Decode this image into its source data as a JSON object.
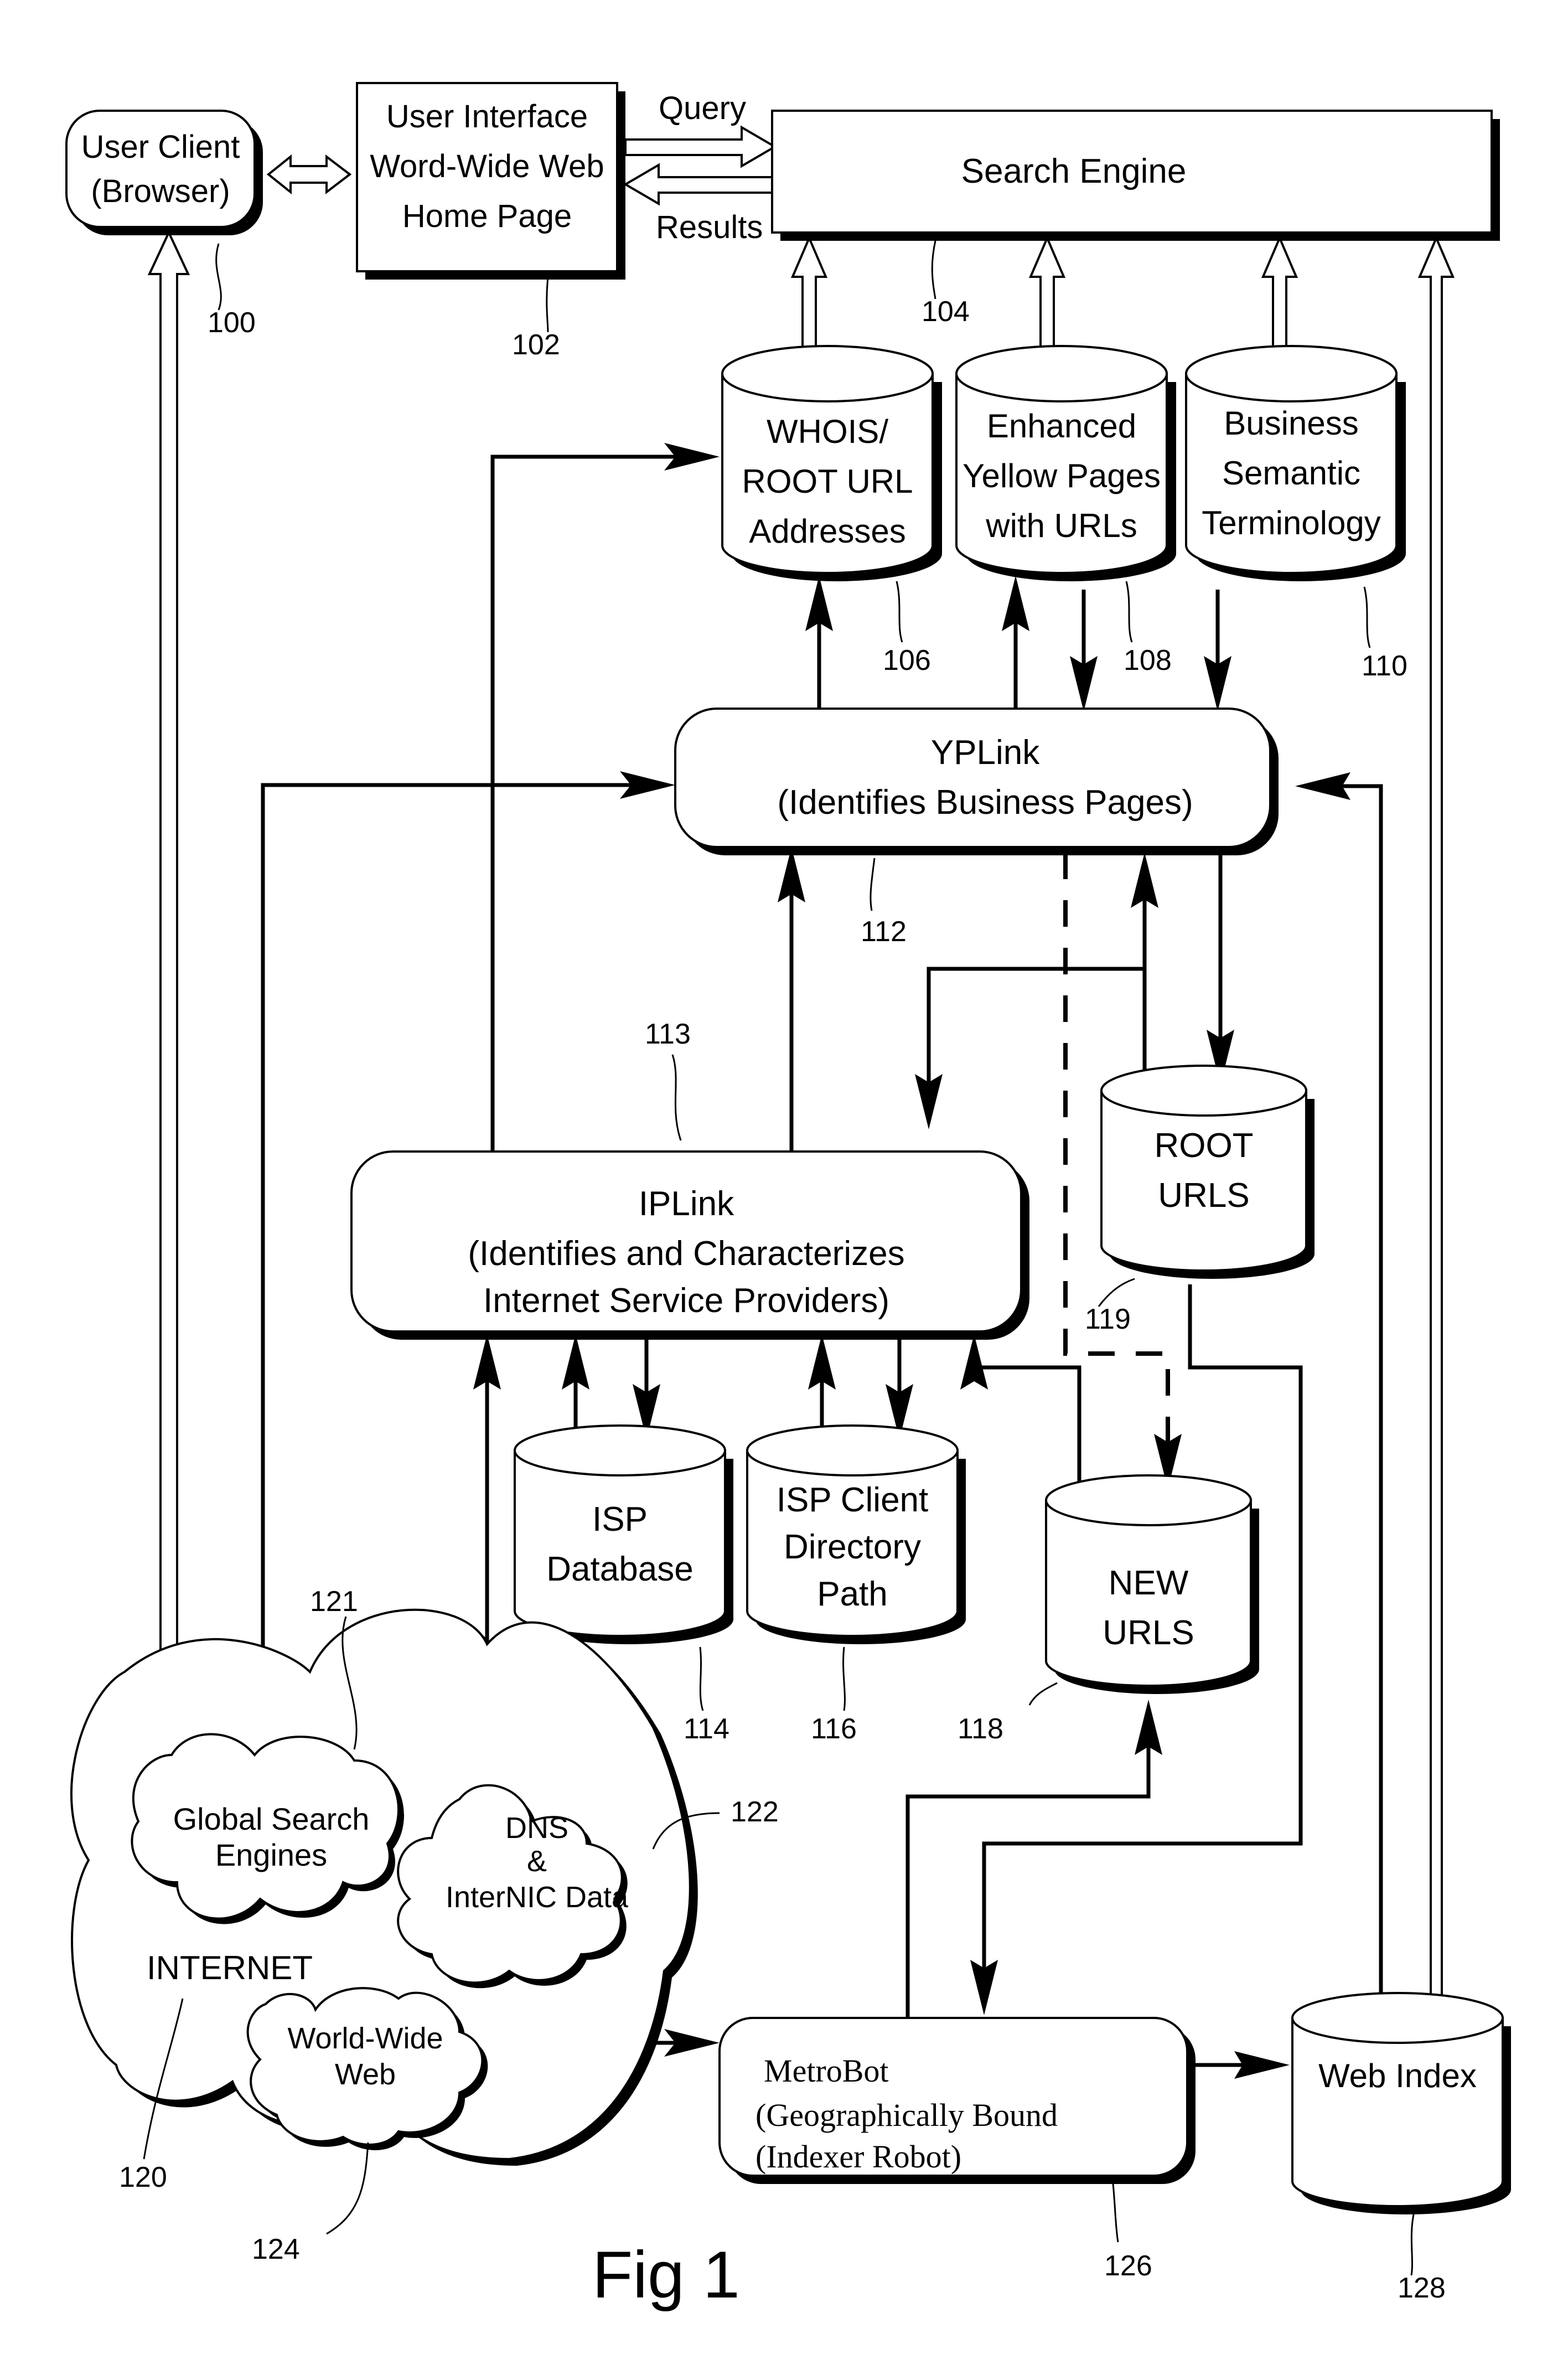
{
  "figure": {
    "caption": "Fig 1"
  },
  "nodes": {
    "user_client": {
      "lines": [
        "User Client",
        "(Browser)"
      ],
      "ref": "100"
    },
    "user_interface": {
      "lines": [
        "User Interface",
        "Word-Wide Web",
        "Home Page"
      ],
      "ref": "102"
    },
    "search_engine": {
      "lines": [
        "Search Engine"
      ],
      "ref": "104"
    },
    "whois": {
      "lines": [
        "WHOIS/",
        "ROOT URL",
        "Addresses"
      ],
      "ref": "106"
    },
    "yellow_pages": {
      "lines": [
        "Enhanced",
        "Yellow Pages",
        "with URLs"
      ],
      "ref": "108"
    },
    "semantic": {
      "lines": [
        "Business",
        "Semantic",
        "Terminology"
      ],
      "ref": "110"
    },
    "yplink": {
      "lines": [
        "YPLink",
        "(Identifies Business Pages)"
      ],
      "ref": "112"
    },
    "iplink": {
      "lines": [
        "IPLink",
        "(Identifies and Characterizes",
        "Internet Service Providers)"
      ],
      "ref": "113"
    },
    "isp_database": {
      "lines": [
        "ISP",
        "Database"
      ],
      "ref": "114"
    },
    "isp_client": {
      "lines": [
        "ISP Client",
        "Directory",
        "Path"
      ],
      "ref": "116"
    },
    "new_urls": {
      "lines": [
        "NEW",
        "URLS"
      ],
      "ref": "118"
    },
    "root_urls": {
      "lines": [
        "ROOT",
        "URLS"
      ],
      "ref": "119"
    },
    "internet": {
      "lines": [
        "INTERNET"
      ],
      "ref": "120"
    },
    "global_search": {
      "lines": [
        "Global Search",
        "Engines"
      ],
      "ref": "121"
    },
    "dns": {
      "lines": [
        "DNS",
        "&",
        "InterNIC Data"
      ],
      "ref": "122"
    },
    "www": {
      "lines": [
        "World-Wide",
        "Web"
      ],
      "ref": "124"
    },
    "metrobot": {
      "lines": [
        "MetroBot",
        "(Geographically Bound",
        "(Indexer Robot)"
      ],
      "ref": "126"
    },
    "web_index": {
      "lines": [
        "Web Index"
      ],
      "ref": "128"
    }
  },
  "edges": {
    "query_label": "Query",
    "results_label": "Results"
  }
}
